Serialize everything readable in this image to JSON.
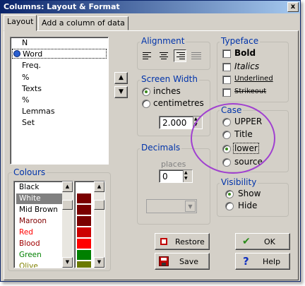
{
  "window": {
    "title": "Columns: Layout & Format",
    "close_glyph": "x"
  },
  "tabs": [
    {
      "label": "Layout",
      "active": true
    },
    {
      "label": "Add a column of data",
      "active": false
    }
  ],
  "columns_list": {
    "items": [
      "N",
      "Word",
      "Freq.",
      "%",
      "Texts",
      "%",
      "Lemmas",
      "Set"
    ],
    "selected": "Word",
    "selected_marker_color": "#2a5fd0"
  },
  "move_up_glyph": "▲",
  "move_down_glyph": "▼",
  "colours": {
    "label": "Colours",
    "names": [
      "Black",
      "White",
      "Mid Brown",
      "Maroon",
      "Red",
      "Blood",
      "Green",
      "Olive"
    ],
    "name_colors": [
      "#000000",
      "#ffffff",
      "#000000",
      "#800000",
      "#ff0000",
      "#a00000",
      "#008000",
      "#808000"
    ],
    "selected": "White",
    "swatches": [
      "#7a0000",
      "#7a0000",
      "#7a0000",
      "#cc0000",
      "#ff0000",
      "#008000",
      "#6b7a00",
      "#00cc00"
    ]
  },
  "alignment": {
    "label": "Alignment",
    "icons": [
      "align-left-icon",
      "align-center-icon",
      "align-right-icon",
      "align-justify-icon"
    ],
    "active": "align-right-icon"
  },
  "screen_width": {
    "label": "Screen Width",
    "options": [
      "inches",
      "centimetres"
    ],
    "selected": "inches",
    "value": "2.000"
  },
  "decimals": {
    "label": "Decimals",
    "places_label": "places",
    "places_value": "0"
  },
  "typeface": {
    "label": "Typeface",
    "bold": "Bold",
    "italics": "Italics",
    "underlined": "Underlined",
    "strikeout": "Strikeout"
  },
  "case": {
    "label": "Case",
    "options": [
      "UPPER",
      "Title",
      "lower",
      "source"
    ],
    "selected": "lower",
    "highlight_color": "#a040d0"
  },
  "visibility": {
    "label": "Visibility",
    "options": [
      "Show",
      "Hide"
    ],
    "selected": "Show"
  },
  "buttons": {
    "restore": "Restore",
    "ok": "OK",
    "save": "Save",
    "help": "Help",
    "help_glyph": "?",
    "ok_glyph": "✔"
  }
}
